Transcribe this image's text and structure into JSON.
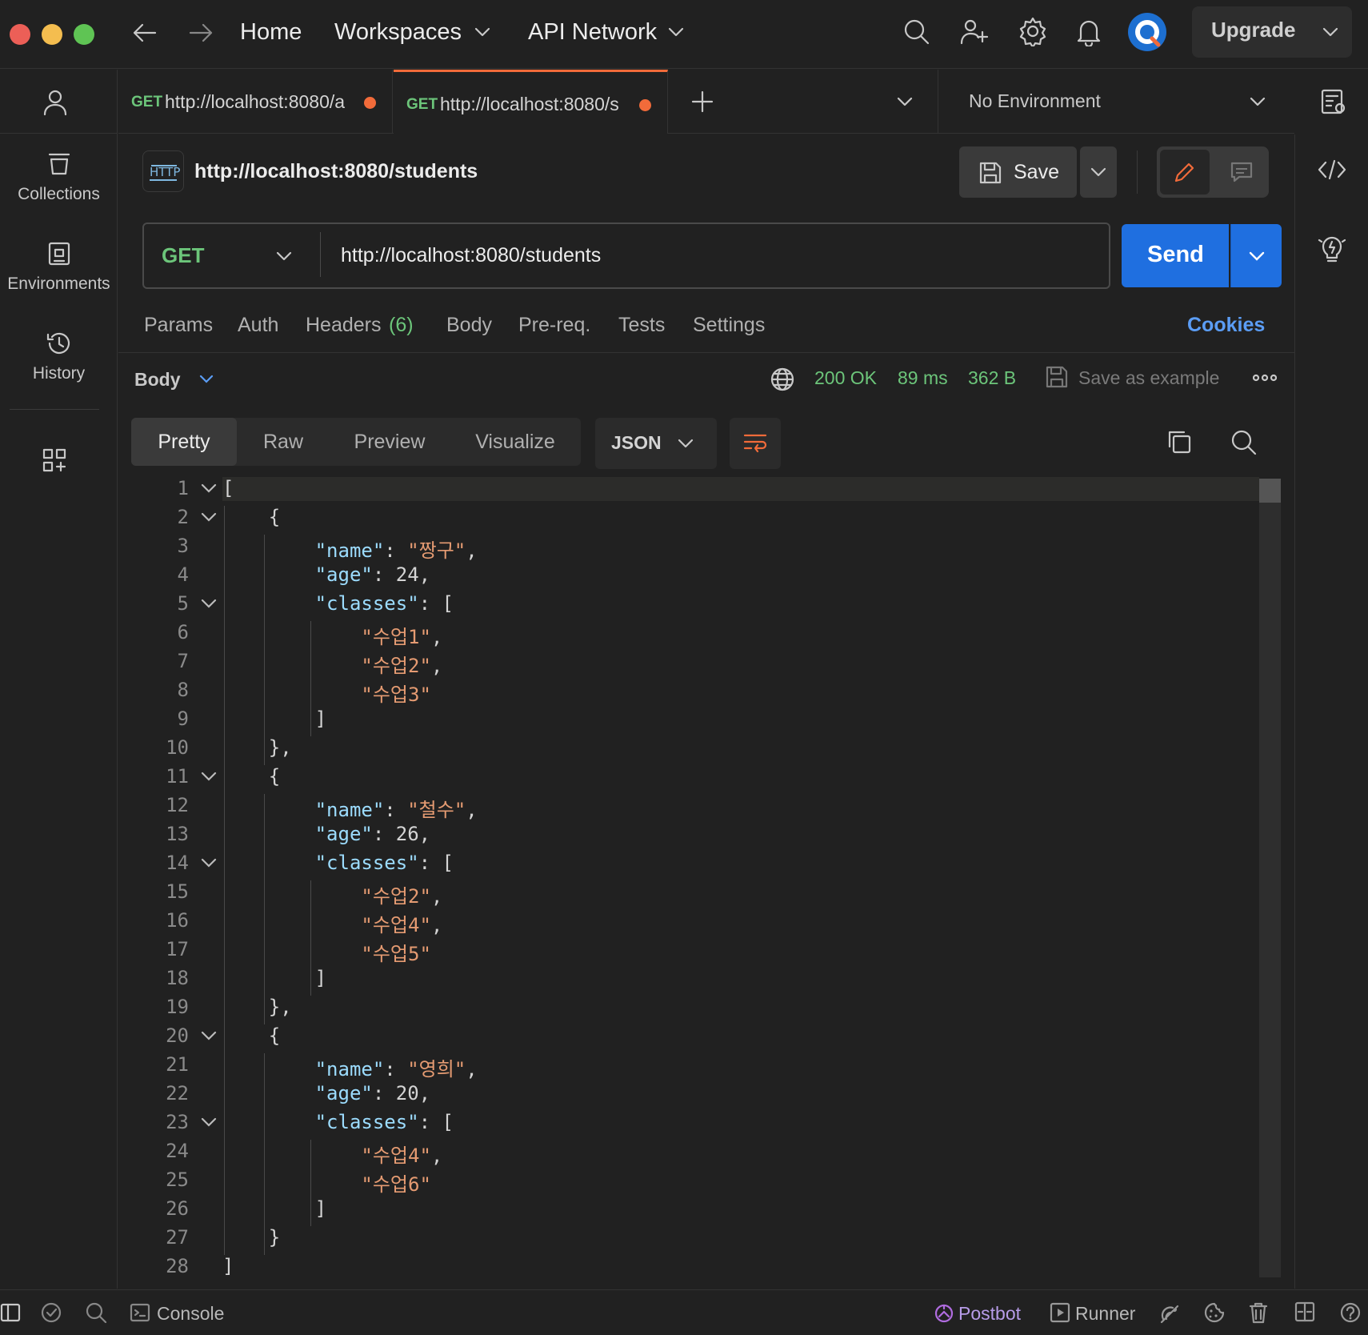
{
  "topbar": {
    "nav_home": "Home",
    "nav_workspaces": "Workspaces",
    "nav_api_network": "API Network",
    "upgrade_label": "Upgrade"
  },
  "tabs": [
    {
      "method": "GET",
      "url": "http://localhost:8080/a"
    },
    {
      "method": "GET",
      "url": "http://localhost:8080/s"
    }
  ],
  "environment": {
    "selected": "No Environment"
  },
  "sidebar": {
    "items": [
      {
        "label": "Collections"
      },
      {
        "label": "Environments"
      },
      {
        "label": "History"
      }
    ]
  },
  "request": {
    "title": "http://localhost:8080/students",
    "save_label": "Save",
    "method": "GET",
    "url": "http://localhost:8080/students",
    "send_label": "Send",
    "tabs": {
      "params": "Params",
      "auth": "Auth",
      "headers": "Headers",
      "headers_count": "(6)",
      "body": "Body",
      "prereq": "Pre-req.",
      "tests": "Tests",
      "settings": "Settings",
      "cookies": "Cookies"
    }
  },
  "response": {
    "section_label": "Body",
    "status": "200 OK",
    "time": "89 ms",
    "size": "362 B",
    "save_example": "Save as example",
    "views": [
      "Pretty",
      "Raw",
      "Preview",
      "Visualize"
    ],
    "format": "JSON"
  },
  "code": {
    "lines": [
      {
        "n": "1",
        "text": "[",
        "fold": true
      },
      {
        "n": "2",
        "text": "    {",
        "fold": true
      },
      {
        "n": "3",
        "key": "name",
        "val": "짱구",
        "kind": "str",
        "tail": ",",
        "indent": 8
      },
      {
        "n": "4",
        "key": "age",
        "val": "24",
        "kind": "num",
        "tail": ",",
        "indent": 8
      },
      {
        "n": "5",
        "key": "classes",
        "open": "[",
        "indent": 8,
        "fold": true
      },
      {
        "n": "6",
        "str": "수업1",
        "tail": ",",
        "indent": 12
      },
      {
        "n": "7",
        "str": "수업2",
        "tail": ",",
        "indent": 12
      },
      {
        "n": "8",
        "str": "수업3",
        "tail": "",
        "indent": 12
      },
      {
        "n": "9",
        "text": "        ]"
      },
      {
        "n": "10",
        "text": "    },"
      },
      {
        "n": "11",
        "text": "    {",
        "fold": true
      },
      {
        "n": "12",
        "key": "name",
        "val": "철수",
        "kind": "str",
        "tail": ",",
        "indent": 8
      },
      {
        "n": "13",
        "key": "age",
        "val": "26",
        "kind": "num",
        "tail": ",",
        "indent": 8
      },
      {
        "n": "14",
        "key": "classes",
        "open": "[",
        "indent": 8,
        "fold": true
      },
      {
        "n": "15",
        "str": "수업2",
        "tail": ",",
        "indent": 12
      },
      {
        "n": "16",
        "str": "수업4",
        "tail": ",",
        "indent": 12
      },
      {
        "n": "17",
        "str": "수업5",
        "tail": "",
        "indent": 12
      },
      {
        "n": "18",
        "text": "        ]"
      },
      {
        "n": "19",
        "text": "    },"
      },
      {
        "n": "20",
        "text": "    {",
        "fold": true
      },
      {
        "n": "21",
        "key": "name",
        "val": "영희",
        "kind": "str",
        "tail": ",",
        "indent": 8
      },
      {
        "n": "22",
        "key": "age",
        "val": "20",
        "kind": "num",
        "tail": ",",
        "indent": 8
      },
      {
        "n": "23",
        "key": "classes",
        "open": "[",
        "indent": 8,
        "fold": true
      },
      {
        "n": "24",
        "str": "수업4",
        "tail": ",",
        "indent": 12
      },
      {
        "n": "25",
        "str": "수업6",
        "tail": "",
        "indent": 12
      },
      {
        "n": "26",
        "text": "        ]"
      },
      {
        "n": "27",
        "text": "    }"
      },
      {
        "n": "28",
        "text": "]"
      }
    ]
  },
  "statusbar": {
    "console": "Console",
    "postbot": "Postbot",
    "runner": "Runner"
  },
  "colors": {
    "accent_orange": "#f26b3a",
    "send_blue": "#1f6fe0",
    "status_green": "#6cc57a",
    "cookies_blue": "#5b9df5",
    "json_key": "#9cdcfe",
    "json_string": "#e59b72"
  }
}
